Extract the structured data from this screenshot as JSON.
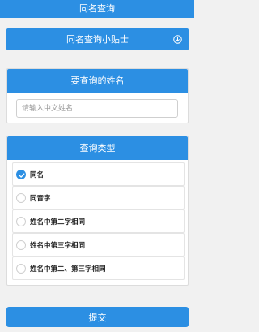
{
  "header": {
    "title": "同名查询"
  },
  "tips": {
    "label": "同名查询小贴士",
    "icon": "arrow-down-circle-icon"
  },
  "name_section": {
    "title": "要查询的姓名",
    "input_value": "",
    "input_placeholder": "请输入中文姓名"
  },
  "type_section": {
    "title": "查询类型",
    "selected_index": 0,
    "options": [
      {
        "label": "同名",
        "checked": true
      },
      {
        "label": "同音字",
        "checked": false
      },
      {
        "label": "姓名中第二字相同",
        "checked": false
      },
      {
        "label": "姓名中第三字相同",
        "checked": false
      },
      {
        "label": "姓名中第二、第三字相同",
        "checked": false
      }
    ]
  },
  "submit": {
    "label": "提交"
  },
  "colors": {
    "accent": "#2c8fe3",
    "background": "#f1f1f1"
  }
}
